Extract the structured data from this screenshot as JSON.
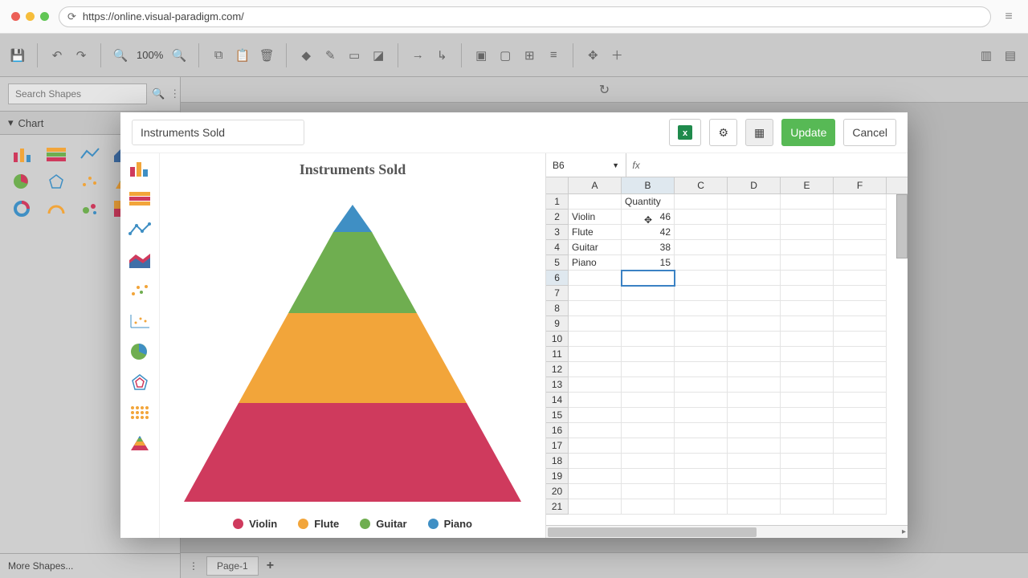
{
  "browser": {
    "url": "https://online.visual-paradigm.com/"
  },
  "toolbar": {
    "zoom": "100%"
  },
  "sidebar": {
    "search_placeholder": "Search Shapes",
    "section_label": "Chart",
    "more_shapes": "More Shapes..."
  },
  "page_tabs": {
    "page1": "Page-1"
  },
  "modal": {
    "title_value": "Instruments Sold",
    "update": "Update",
    "cancel": "Cancel"
  },
  "spreadsheet": {
    "active_cell": "B6",
    "formula": "",
    "columns": [
      "A",
      "B",
      "C",
      "D",
      "E",
      "F"
    ],
    "header_row": {
      "B": "Quantity"
    },
    "rows": [
      {
        "A": "Violin",
        "B": "46"
      },
      {
        "A": "Flute",
        "B": "42"
      },
      {
        "A": "Guitar",
        "B": "38"
      },
      {
        "A": "Piano",
        "B": "15"
      }
    ],
    "visible_row_count": 21
  },
  "chart_data": {
    "type": "pyramid",
    "title": "Instruments Sold",
    "series_label": "Quantity",
    "categories": [
      "Violin",
      "Flute",
      "Guitar",
      "Piano"
    ],
    "values": [
      46,
      42,
      38,
      15
    ],
    "colors": {
      "Violin": "#cf3a5d",
      "Flute": "#f2a53a",
      "Guitar": "#6fae50",
      "Piano": "#3f8fc4"
    },
    "legend_position": "bottom"
  }
}
